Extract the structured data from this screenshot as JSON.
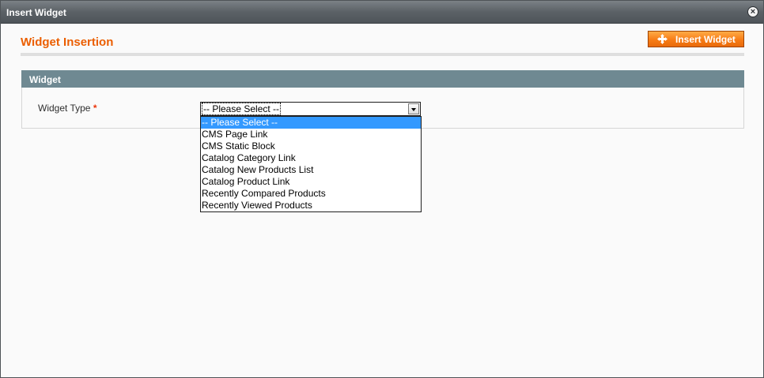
{
  "window": {
    "title": "Insert Widget"
  },
  "header": {
    "title": "Widget Insertion",
    "insert_button": "Insert Widget"
  },
  "fieldset": {
    "legend": "Widget"
  },
  "widget_type": {
    "label": "Widget Type",
    "required_mark": "*",
    "selected": "-- Please Select --",
    "options": [
      "-- Please Select --",
      "CMS Page Link",
      "CMS Static Block",
      "Catalog Category Link",
      "Catalog New Products List",
      "Catalog Product Link",
      "Recently Compared Products",
      "Recently Viewed Products"
    ]
  },
  "colors": {
    "accent": "#eb5e00",
    "button": "#f77c16",
    "section_header": "#6f8992",
    "selection": "#3399ff"
  }
}
